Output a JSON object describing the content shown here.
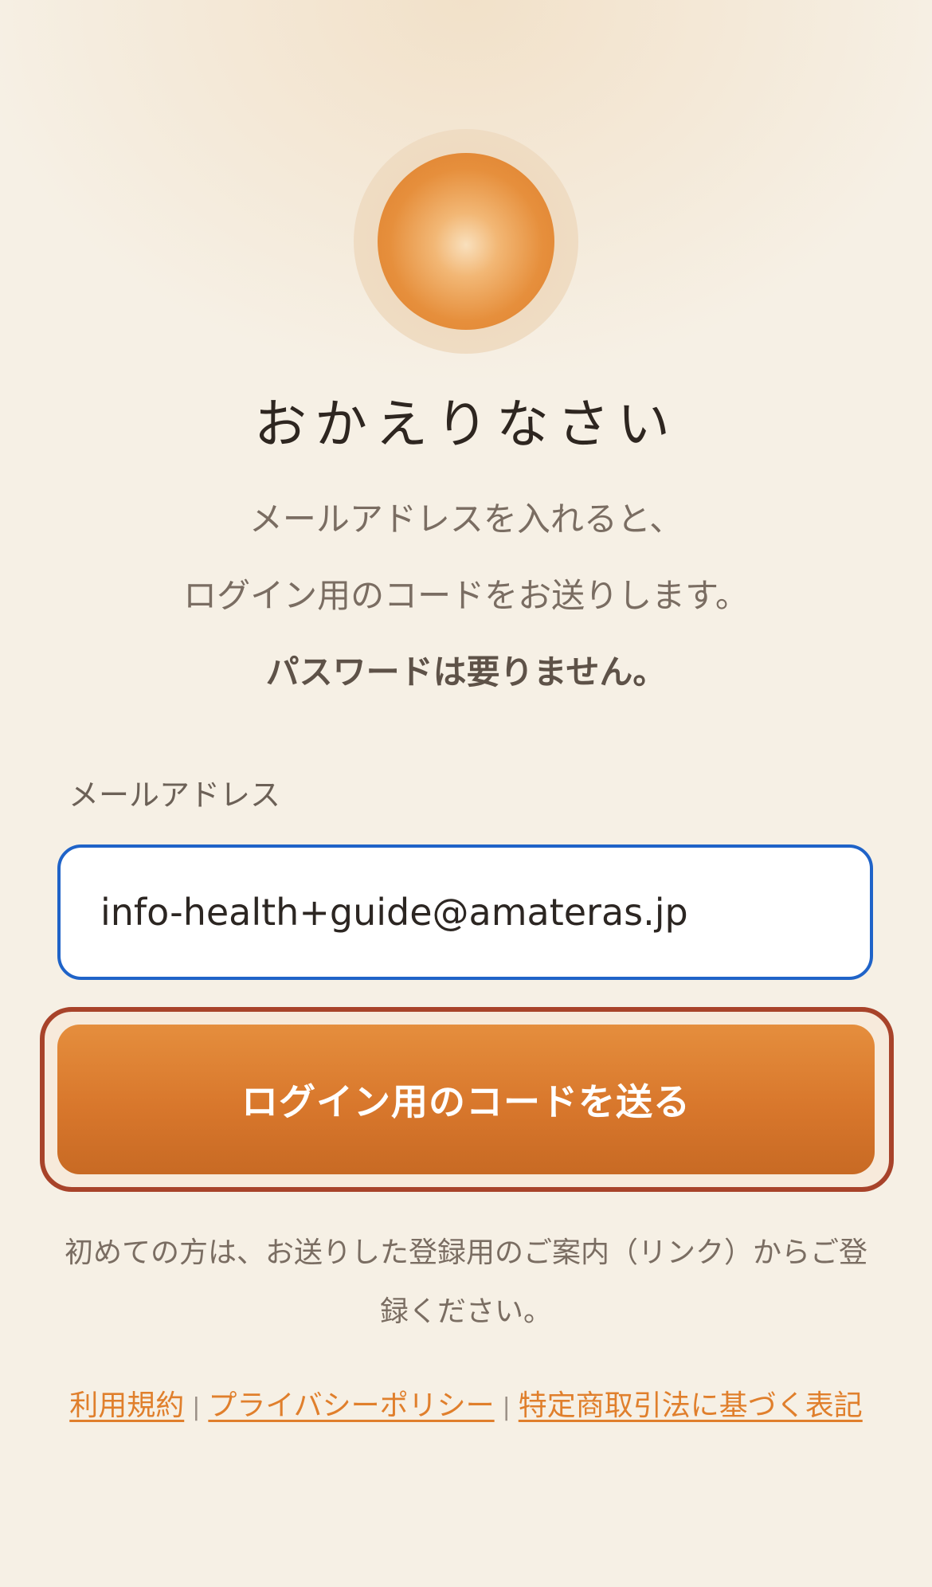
{
  "hero": {
    "icon": "sun-icon",
    "title": "おかえりなさい",
    "subtitle_line1": "メールアドレスを入れると、",
    "subtitle_line2": "ログイン用のコードをお送りします。",
    "subtitle_line3": "パスワードは要りません。"
  },
  "form": {
    "email_label": "メールアドレス",
    "email_value": "info-health+guide@amateras.jp",
    "submit_label": "ログイン用のコードを送る"
  },
  "note": {
    "line1": "初めての方は、お送りした登録用のご案内（リンク）からご登",
    "line2": "録ください。"
  },
  "footer": {
    "terms": "利用規約",
    "separator": "|",
    "privacy": "プライバシーポリシー",
    "commerce": "特定商取引法に基づく表記"
  },
  "colors": {
    "accent": "#d8772c",
    "focus_border": "#1f63c8",
    "button_outline": "#a8432a",
    "link": "#e07f2c",
    "background": "#f6f0e5"
  }
}
